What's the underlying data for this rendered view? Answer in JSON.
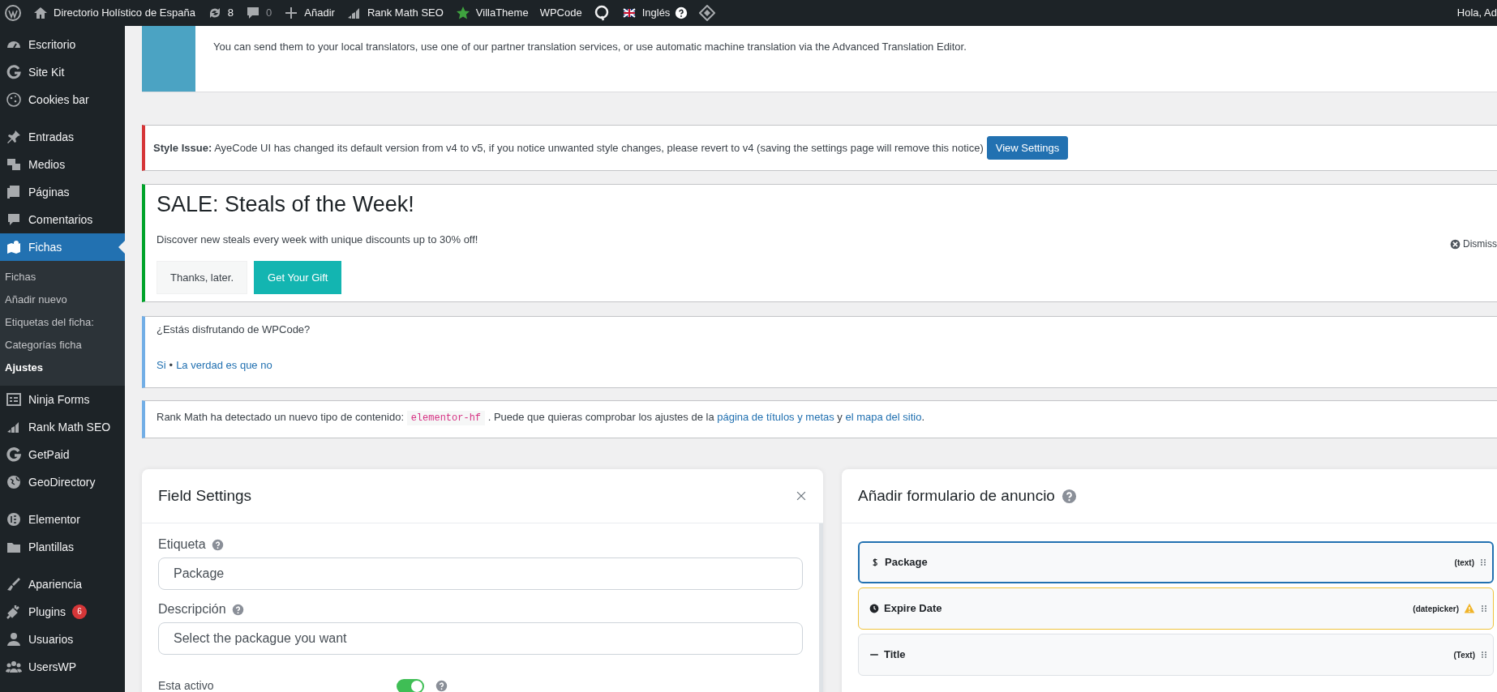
{
  "admin_bar": {
    "items": [
      {
        "kind": "wp-logo"
      },
      {
        "kind": "home",
        "label": "Directorio Holístico de España"
      },
      {
        "kind": "updates",
        "label": "8"
      },
      {
        "kind": "comments",
        "label": "0"
      },
      {
        "kind": "add",
        "label": "Añadir"
      },
      {
        "kind": "rankmath",
        "label": "Rank Math SEO"
      },
      {
        "kind": "star",
        "label": "VillaTheme"
      },
      {
        "kind": "text",
        "label": "WPCode"
      },
      {
        "kind": "q-logo"
      },
      {
        "kind": "flag",
        "label": "Inglés"
      },
      {
        "kind": "diamond"
      }
    ],
    "greeting": "Hola, Ad"
  },
  "sidebar": {
    "groups": [
      {
        "items": [
          {
            "label": "Escritorio",
            "selected": false
          },
          {
            "label": "Site Kit",
            "selected": false
          },
          {
            "label": "Cookies bar",
            "selected": false
          }
        ]
      },
      {
        "items": [
          {
            "label": "Entradas",
            "selected": false
          },
          {
            "label": "Medios",
            "selected": false
          },
          {
            "label": "Páginas",
            "selected": false
          },
          {
            "label": "Comentarios",
            "selected": false
          },
          {
            "label": "Fichas",
            "selected": true,
            "children": [
              {
                "label": "Fichas",
                "selected": false
              },
              {
                "label": "Añadir nuevo",
                "selected": false
              },
              {
                "label": "Etiquetas del ficha:",
                "selected": false
              },
              {
                "label": "Categorías ficha",
                "selected": false
              },
              {
                "label": "Ajustes",
                "selected": true
              }
            ]
          },
          {
            "label": "Ninja Forms",
            "selected": false
          },
          {
            "label": "Rank Math SEO",
            "selected": false
          },
          {
            "label": "GetPaid",
            "selected": false
          },
          {
            "label": "GeoDirectory",
            "selected": false
          }
        ]
      },
      {
        "items": [
          {
            "label": "Elementor",
            "selected": false
          },
          {
            "label": "Plantillas",
            "selected": false
          }
        ]
      },
      {
        "items": [
          {
            "label": "Apariencia",
            "selected": false
          },
          {
            "label": "Plugins",
            "selected": false,
            "badge": "6"
          },
          {
            "label": "Usuarios",
            "selected": false
          },
          {
            "label": "UsersWP",
            "selected": false
          }
        ]
      }
    ]
  },
  "notices": [
    {
      "kind": "translation",
      "text": "You can send them to your local translators, use one of our partner translation services, or use automatic machine translation via the Advanced Translation Editor."
    },
    {
      "kind": "error",
      "text": "**Style Issue:** AyeCode UI has changed its default version from v4 to v5, if you notice unwanted style changes, please revert to v4 (saving the settings page will remove this notice)",
      "button": "View Settings"
    },
    {
      "kind": "sale",
      "title": "SALE: Steals of the Week!",
      "text": "Discover new steals every week with unique discounts up to 30% off!",
      "dismiss": "Dismiss",
      "buttons": [
        {
          "label": "Thanks, later.",
          "primary": false
        },
        {
          "label": "Get Your Gift",
          "primary": true
        }
      ]
    },
    {
      "kind": "feedback",
      "question": "¿Estás disfrutando de WPCode?",
      "links": [
        "Si",
        "La verdad es que no"
      ],
      "separator": "•"
    },
    {
      "kind": "info",
      "parts": [
        {
          "kind": "text",
          "text": "Rank Math ha detectado un nuevo tipo de contenido: "
        },
        {
          "kind": "code",
          "text": "elementor-hf"
        },
        {
          "kind": "text",
          "text": " . Puede que quieras comprobar los ajustes de la "
        },
        {
          "kind": "link",
          "text": "página de títulos y metas"
        },
        {
          "kind": "text",
          "text": " y "
        },
        {
          "kind": "link",
          "text": "el mapa del sitio"
        },
        {
          "kind": "text",
          "text": "."
        }
      ]
    }
  ],
  "field_settings": {
    "title": "Field Settings",
    "fields": [
      {
        "label": "Etiqueta",
        "value": "Package"
      },
      {
        "label": "Descripción",
        "value": "Select the packague you want"
      }
    ],
    "toggle": {
      "label": "Esta activo",
      "on": true
    }
  },
  "form_builder": {
    "title": "Añadir formulario de anuncio",
    "rows": [
      {
        "kind": "dollar",
        "label": "Package",
        "type": "(text)",
        "selected": true,
        "warning": false
      },
      {
        "kind": "clock",
        "label": "Expire Date",
        "type": "(datepicker)",
        "selected": false,
        "warning": true
      },
      {
        "kind": "minus",
        "label": "Title",
        "type": "(Text)",
        "selected": false,
        "warning": false
      }
    ]
  }
}
